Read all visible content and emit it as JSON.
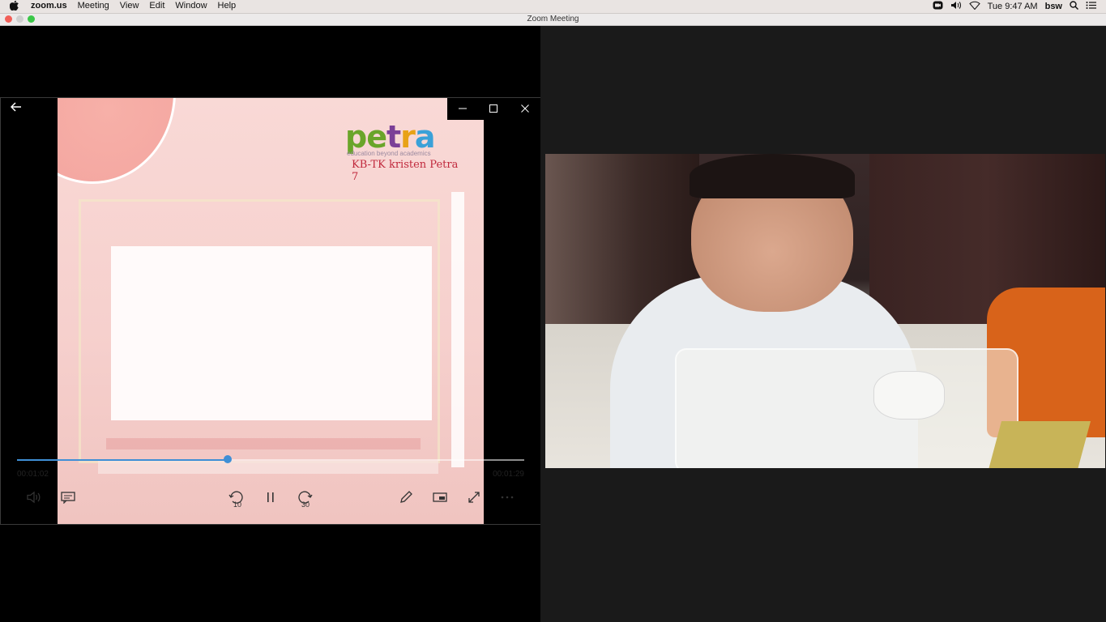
{
  "menubar": {
    "apple": "",
    "app": "zoom.us",
    "items": [
      "Meeting",
      "View",
      "Edit",
      "Window",
      "Help"
    ],
    "clock": "Tue 9:47 AM",
    "user": "bsw"
  },
  "window": {
    "title": "Zoom Meeting"
  },
  "player": {
    "logo_text": "petra",
    "logo_tagline": "education beyond academics",
    "school_name": "KB-TK kristen Petra 7",
    "elapsed": "00:01:02",
    "total": "00:01:29",
    "progress_fraction": 0.415,
    "rewind_label": "10",
    "forward_label": "30"
  },
  "icons": {
    "back": "arrow-left",
    "minimize": "minimize",
    "maximize": "maximize",
    "close": "close",
    "volume": "volume",
    "subtitles": "subtitles",
    "rewind": "rewind-10",
    "pause": "pause",
    "forward": "forward-30",
    "edit": "pencil",
    "mini_view": "mini-view",
    "fullscreen": "fullscreen",
    "more": "more"
  }
}
